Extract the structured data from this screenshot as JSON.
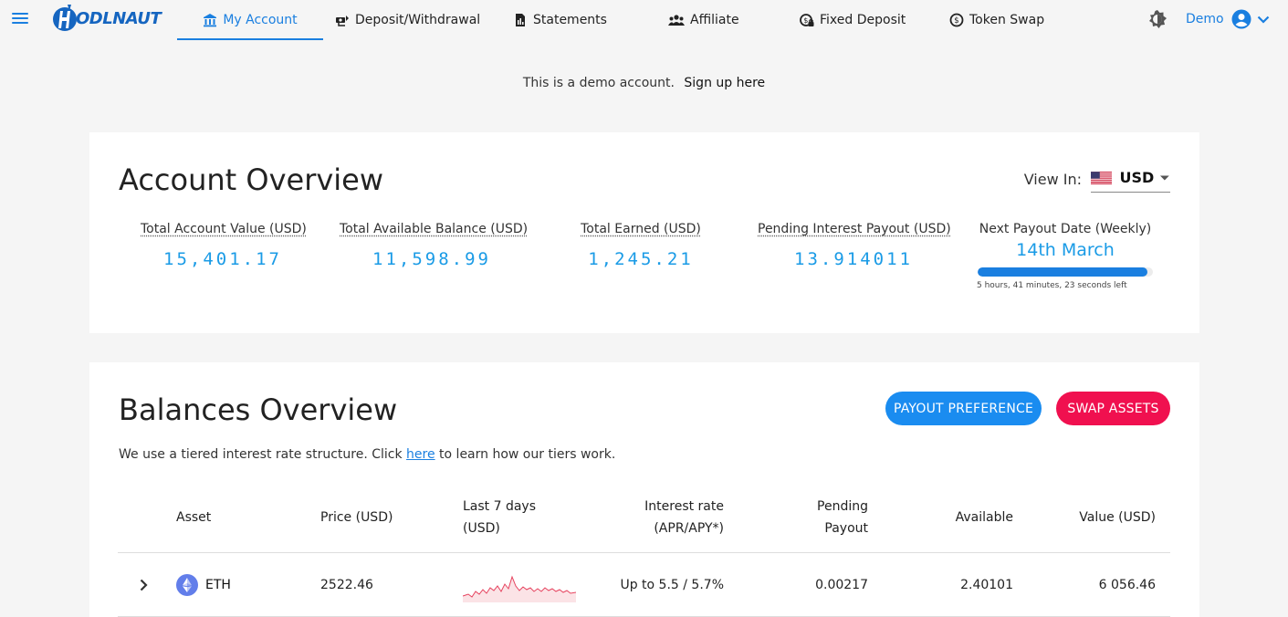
{
  "brand": {
    "logo_text": "ODLNAUT"
  },
  "nav": [
    {
      "label": "My Account",
      "icon": "bank-icon",
      "active": true
    },
    {
      "label": "Deposit/Withdrawal",
      "icon": "cash-exchange-icon"
    },
    {
      "label": "Statements",
      "icon": "document-icon"
    },
    {
      "label": "Affiliate",
      "icon": "people-icon"
    },
    {
      "label": "Fixed Deposit",
      "icon": "lock-coin-icon"
    },
    {
      "label": "Token Swap",
      "icon": "swap-coin-icon"
    }
  ],
  "user": {
    "name": "Demo"
  },
  "demo_banner": {
    "text": "This is a demo account.",
    "link": "Sign up here"
  },
  "account_overview": {
    "title": "Account Overview",
    "view_in_label": "View In:",
    "currency": "USD",
    "stats": [
      {
        "label": "Total Account Value (USD)",
        "value": "15,401.17"
      },
      {
        "label": "Total Available Balance (USD)",
        "value": "11,598.99"
      },
      {
        "label": "Total Earned (USD)",
        "value": "1,245.21"
      },
      {
        "label": "Pending Interest Payout (USD)",
        "value": "13.914011"
      }
    ],
    "next_payout": {
      "label": "Next Payout Date (Weekly)",
      "date": "14th March",
      "progress_fraction": 0.97,
      "time_left": "5 hours, 41 minutes, 23 seconds left"
    }
  },
  "balances_overview": {
    "title": "Balances Overview",
    "payout_button": "PAYOUT PREFERENCE",
    "swap_button": "SWAP ASSETS",
    "tier_note_before": "We use a tiered interest rate structure. Click",
    "tier_note_link": "here",
    "tier_note_after": "to learn how our tiers work.",
    "columns": {
      "asset": "Asset",
      "price": "Price (USD)",
      "last7_line1": "Last 7 days",
      "last7_line2": "(USD)",
      "rate_line1": "Interest rate",
      "rate_line2": "(APR/APY*)",
      "pending_line1": "Pending",
      "pending_line2": "Payout",
      "available": "Available",
      "value": "Value (USD)"
    },
    "rows": [
      {
        "asset": "ETH",
        "price": "2522.46",
        "rate": "Up to 5.5 / 5.7%",
        "pending": "0.00217",
        "available": "2.40101",
        "value": "6 056.46"
      }
    ]
  },
  "colors": {
    "accent": "#1a7fe0",
    "value_blue": "#1a9be6",
    "swap_red": "#f0104f"
  }
}
